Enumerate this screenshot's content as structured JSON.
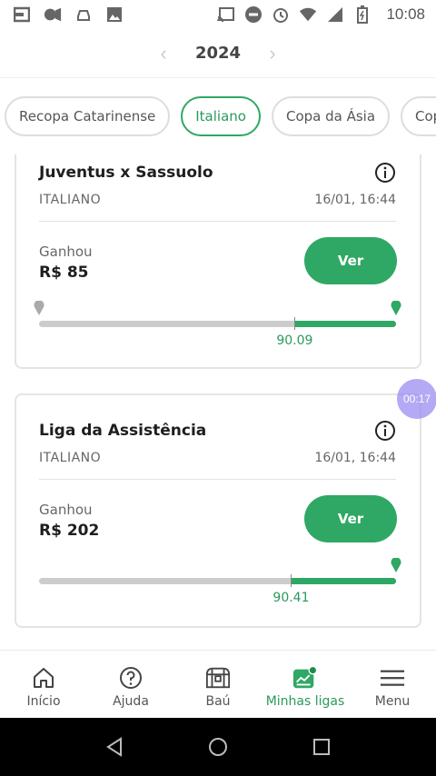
{
  "status_bar": {
    "time": "10:08",
    "icons": [
      "square-icon",
      "video-icon",
      "car-icon",
      "image-icon",
      "cast-icon",
      "dnd-icon",
      "alarm-icon",
      "wifi-icon",
      "signal-icon",
      "battery-icon"
    ]
  },
  "year_selector": {
    "year": "2024",
    "prev": "‹",
    "next": "›"
  },
  "filter_chips": [
    {
      "label": "Recopa Catarinense",
      "active": false
    },
    {
      "label": "Italiano",
      "active": true
    },
    {
      "label": "Copa da Ásia",
      "active": false
    },
    {
      "label": "Copa",
      "active": false
    }
  ],
  "cards": [
    {
      "title": "Juventus x Sassuolo",
      "league": "ITALIANO",
      "date": "16/01, 16:44",
      "result_label": "Ganhou",
      "result_value": "R$ 85",
      "button_label": "Ver",
      "marker_value": "90.09",
      "marker_fraction": 0.716
    },
    {
      "title": "Liga da Assistência",
      "league": "ITALIANO",
      "date": "16/01, 16:44",
      "result_label": "Ganhou",
      "result_value": "R$ 202",
      "button_label": "Ver",
      "marker_value": "90.41",
      "marker_fraction": 0.706
    }
  ],
  "floating_timer": "00:17",
  "bottom_nav": [
    {
      "label": "Início",
      "icon": "home-icon",
      "active": false
    },
    {
      "label": "Ajuda",
      "icon": "help-icon",
      "active": false
    },
    {
      "label": "Baú",
      "icon": "chest-icon",
      "active": false
    },
    {
      "label": "Minhas ligas",
      "icon": "leagues-icon",
      "active": true
    },
    {
      "label": "Menu",
      "icon": "menu-icon",
      "active": false
    }
  ],
  "colors": {
    "accent": "#2fa865",
    "track": "#cccccc",
    "timer": "#9b8cf0"
  }
}
